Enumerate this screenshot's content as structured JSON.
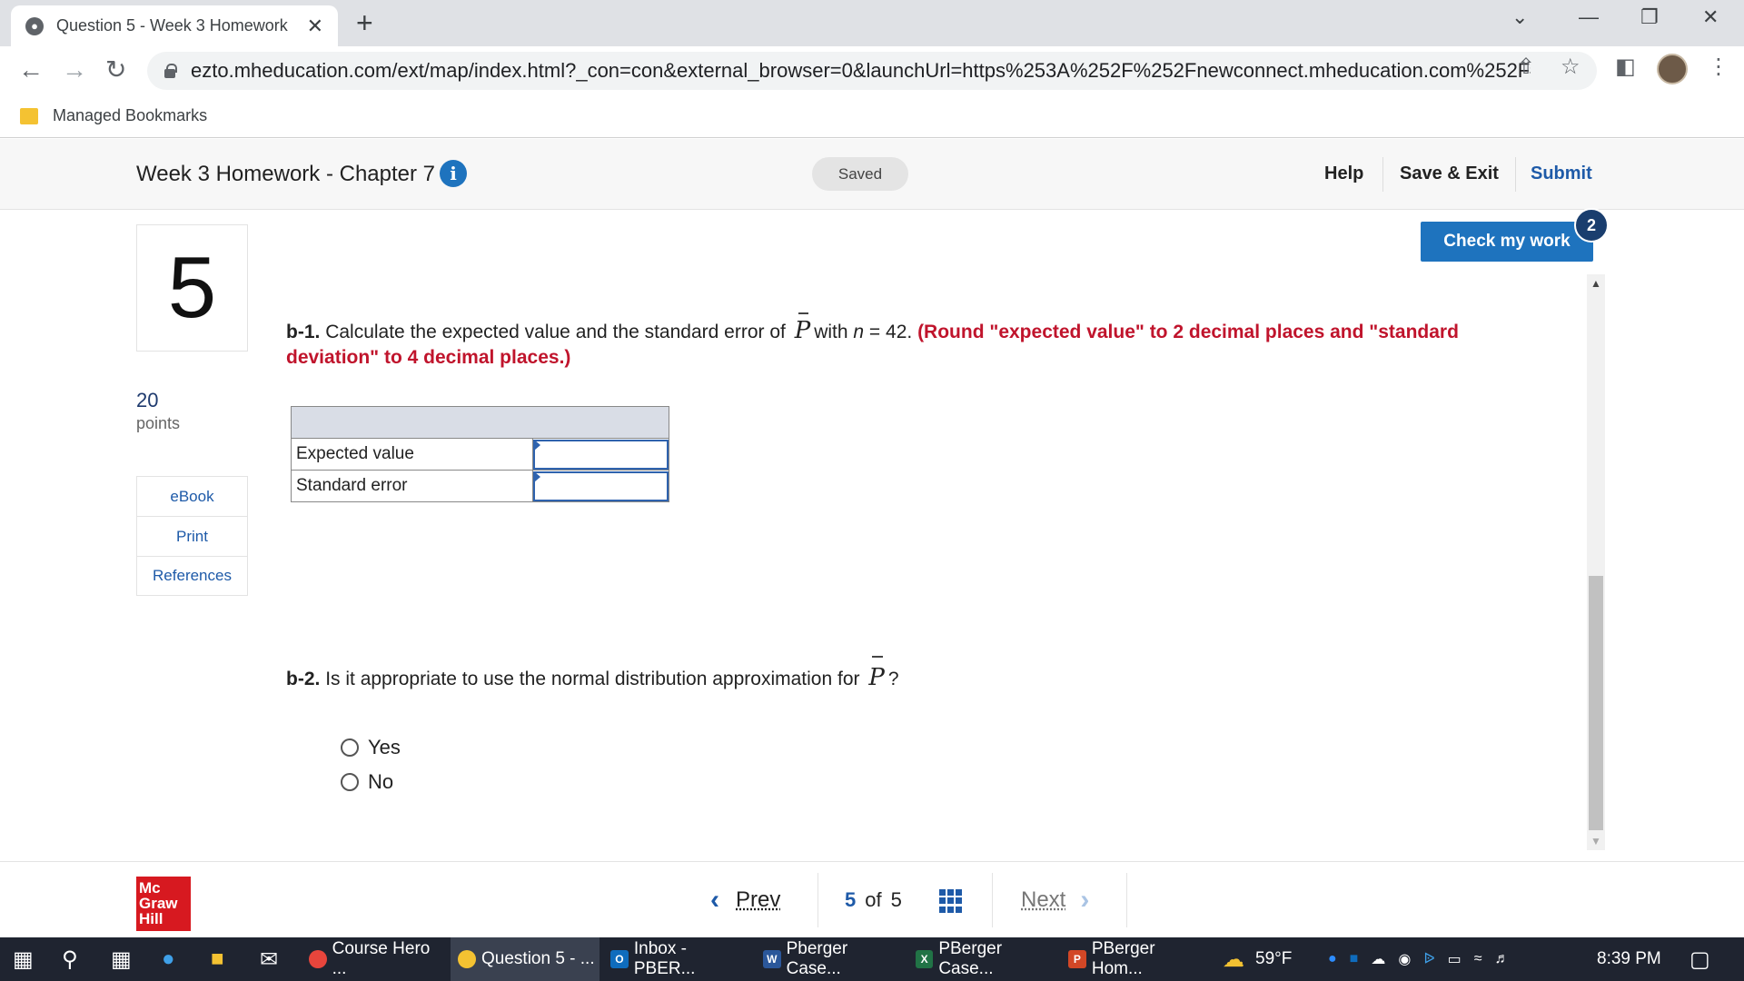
{
  "browser": {
    "tab_title": "Question 5 - Week 3 Homework",
    "new_tab": "+",
    "url": "ezto.mheducation.com/ext/map/index.html?_con=con&external_browser=0&launchUrl=https%253A%252F%252Fnewconnect.mheducation.com%252F#/...",
    "bookmarks_folder": "Managed Bookmarks"
  },
  "header": {
    "title": "Week 3 Homework - Chapter 7",
    "info_glyph": "i",
    "saved_label": "Saved",
    "help_label": "Help",
    "save_exit_label": "Save & Exit",
    "submit_label": "Submit"
  },
  "question": {
    "number": "5",
    "points_value": "20",
    "points_label": "points",
    "links": [
      "eBook",
      "Print",
      "References"
    ],
    "check_label": "Check my work",
    "check_badge": "2",
    "b1_part": "b-1.",
    "b1_text_before": "Calculate the expected value and the standard error of",
    "b1_symbol": "P",
    "b1_text_with": "with",
    "b1_n": "n",
    "b1_text_after": "= 42.",
    "b1_instruction": "(Round \"expected value\" to 2 decimal places and \"standard deviation\" to 4 decimal places.)",
    "table_rows": [
      {
        "label": "Expected value",
        "value": ""
      },
      {
        "label": "Standard error",
        "value": ""
      }
    ],
    "b2_part": "b-2.",
    "b2_text": "Is it appropriate to use the normal distribution approximation for",
    "b2_symbol": "P",
    "b2_end": "?",
    "options": [
      "Yes",
      "No"
    ]
  },
  "footer": {
    "logo": "Mc Graw Hill",
    "prev_label": "Prev",
    "current_page": "5",
    "of_label": "of",
    "total_pages": "5",
    "next_label": "Next"
  },
  "taskbar": {
    "apps": [
      "Course Hero ...",
      "Question 5 - ...",
      "Inbox - PBER...",
      "Pberger Case...",
      "PBerger Case...",
      "PBerger Hom..."
    ],
    "weather": "59°F",
    "time": "8:39 PM"
  }
}
